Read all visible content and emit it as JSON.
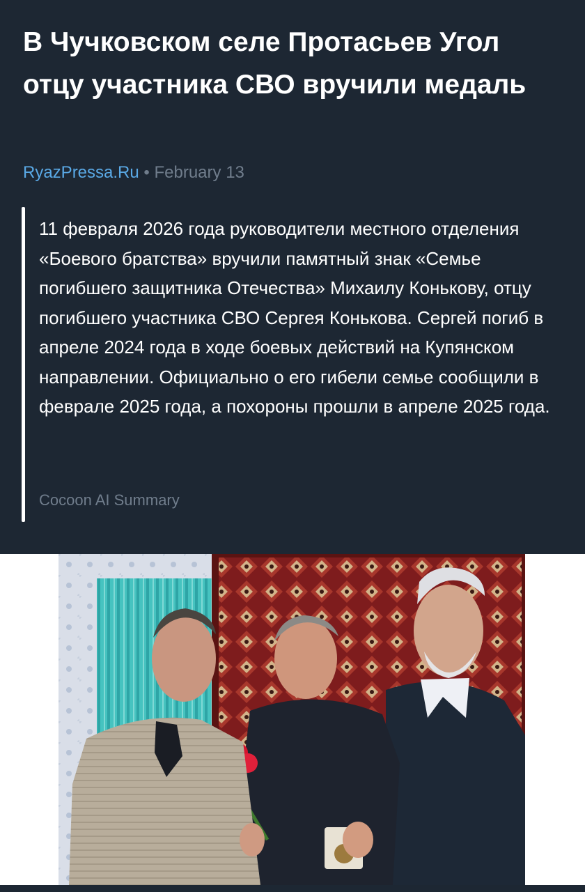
{
  "article": {
    "title": "В Чучковском селе Протасьев Угол отцу участника СВО вручили медаль",
    "source": "RyazPressa.Ru",
    "separator": "•",
    "date": "February 13",
    "summary": "11 февраля 2026 года руководители местного отделения «Боевого братства» вручили памятный знак «Семье погибшего защитника Отечества» Михаилу Конькову, отцу погибшего участника СВО Сергея Конькова. Сергей погиб в апреле 2024 года в ходе боевых действий на Купянском направлении. Официально о его гибели семье сообщили в феврале 2025 года, а похороны прошли в апреле 2025 года.",
    "summary_label": "Cocoon AI Summary"
  },
  "colors": {
    "background": "#1d2733",
    "text": "#ffffff",
    "link": "#5aa9e6",
    "muted": "#707d8c"
  },
  "photo": {
    "alt": "Three men standing indoors in front of a patterned red carpet; the man in the middle holds red carnations and a medal"
  }
}
